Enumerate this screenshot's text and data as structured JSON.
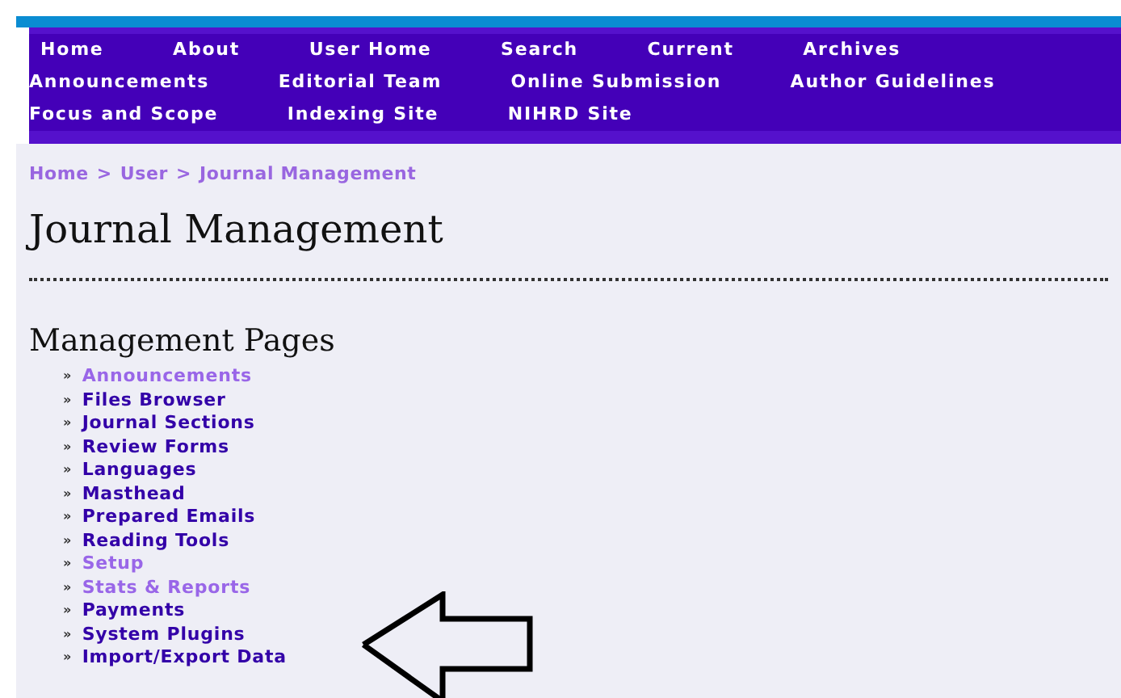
{
  "nav": [
    {
      "label": "Home"
    },
    {
      "label": "About"
    },
    {
      "label": "User Home"
    },
    {
      "label": "Search"
    },
    {
      "label": "Current"
    },
    {
      "label": "Archives"
    },
    {
      "label": "Announcements"
    },
    {
      "label": "Editorial Team"
    },
    {
      "label": "Online Submission"
    },
    {
      "label": "Author Guidelines"
    },
    {
      "label": "Focus and Scope"
    },
    {
      "label": "Indexing Site"
    },
    {
      "label": "NIHRD Site"
    }
  ],
  "breadcrumb": [
    {
      "label": "Home",
      "separator": ">"
    },
    {
      "label": "User",
      "separator": ">"
    },
    {
      "label": "Journal Management"
    }
  ],
  "title": "Journal Management",
  "section_heading": "Management Pages",
  "pages": [
    {
      "bullet": "»",
      "label": "Announcements",
      "visited": true
    },
    {
      "bullet": "»",
      "label": "Files Browser",
      "visited": false
    },
    {
      "bullet": "»",
      "label": "Journal Sections",
      "visited": false
    },
    {
      "bullet": "»",
      "label": "Review Forms",
      "visited": false
    },
    {
      "bullet": "»",
      "label": "Languages",
      "visited": false
    },
    {
      "bullet": "»",
      "label": "Masthead",
      "visited": false
    },
    {
      "bullet": "»",
      "label": "Prepared Emails",
      "visited": false
    },
    {
      "bullet": "»",
      "label": "Reading Tools",
      "visited": false
    },
    {
      "bullet": "»",
      "label": "Setup",
      "visited": true
    },
    {
      "bullet": "»",
      "label": "Stats & Reports",
      "visited": true
    },
    {
      "bullet": "»",
      "label": "Payments",
      "visited": false
    },
    {
      "bullet": "»",
      "label": "System Plugins",
      "visited": false
    },
    {
      "bullet": "»",
      "label": "Import/Export Data",
      "visited": false
    }
  ]
}
